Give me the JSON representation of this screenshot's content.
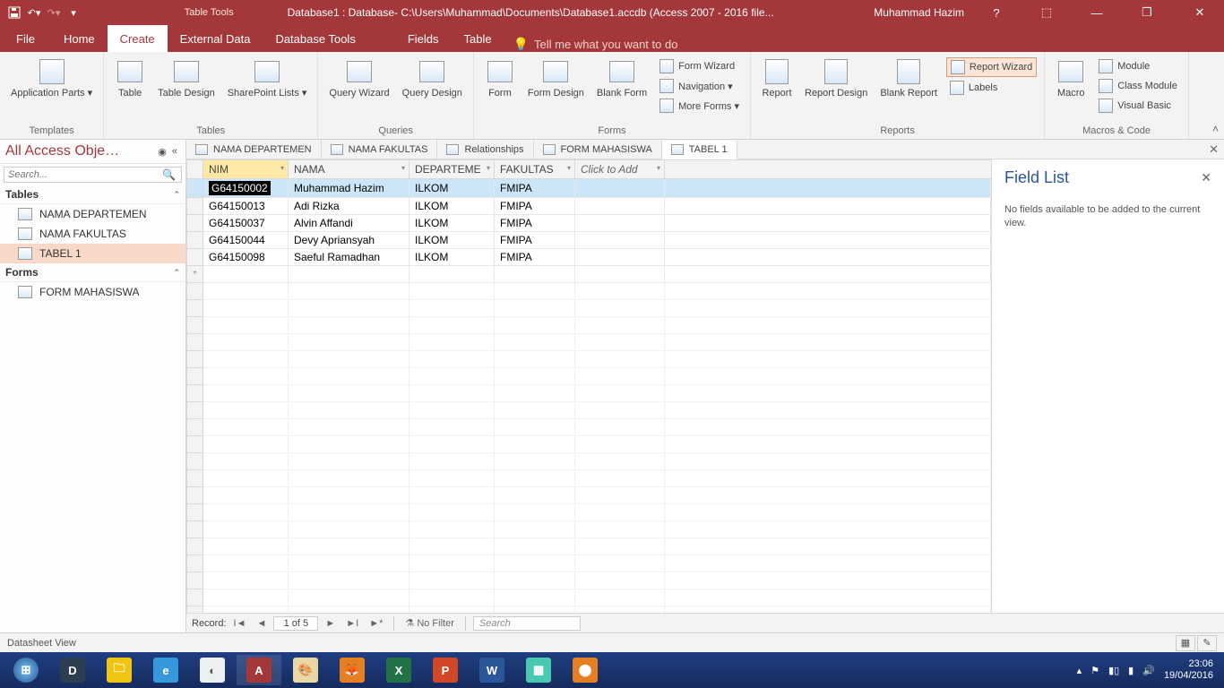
{
  "titlebar": {
    "table_tools": "Table Tools",
    "title": "Database1 : Database- C:\\Users\\Muhammad\\Documents\\Database1.accdb (Access 2007 - 2016 file...",
    "user": "Muhammad Hazim"
  },
  "tabs": {
    "file": "File",
    "home": "Home",
    "create": "Create",
    "external": "External Data",
    "dbtools": "Database Tools",
    "fields": "Fields",
    "table": "Table",
    "tellme": "Tell me what you want to do"
  },
  "ribbon": {
    "templates": {
      "app_parts": "Application\nParts ▾",
      "group": "Templates"
    },
    "tables": {
      "table": "Table",
      "table_design": "Table\nDesign",
      "sp_lists": "SharePoint\nLists ▾",
      "group": "Tables"
    },
    "queries": {
      "qwizard": "Query\nWizard",
      "qdesign": "Query\nDesign",
      "group": "Queries"
    },
    "forms": {
      "form": "Form",
      "form_design": "Form\nDesign",
      "blank_form": "Blank\nForm",
      "form_wizard": "Form Wizard",
      "navigation": "Navigation ▾",
      "more_forms": "More Forms ▾",
      "group": "Forms"
    },
    "reports": {
      "report": "Report",
      "report_design": "Report\nDesign",
      "blank_report": "Blank\nReport",
      "report_wizard": "Report Wizard",
      "labels": "Labels",
      "group": "Reports"
    },
    "macros": {
      "macro": "Macro",
      "module": "Module",
      "class_module": "Class Module",
      "visual_basic": "Visual Basic",
      "group": "Macros & Code"
    }
  },
  "nav": {
    "header": "All Access Obje…",
    "search_placeholder": "Search...",
    "tables_label": "Tables",
    "forms_label": "Forms",
    "tables": [
      "NAMA DEPARTEMEN",
      "NAMA FAKULTAS",
      "TABEL 1"
    ],
    "forms": [
      "FORM MAHASISWA"
    ]
  },
  "doctabs": [
    "NAMA DEPARTEMEN",
    "NAMA FAKULTAS",
    "Relationships",
    "FORM MAHASISWA",
    "TABEL 1"
  ],
  "columns": {
    "c1": "NIM",
    "c2": "NAMA",
    "c3": "DEPARTEME",
    "c4": "FAKULTAS",
    "c5": "Click to Add"
  },
  "rows": [
    {
      "nim": "G64150002",
      "nama": "Muhammad Hazim",
      "dep": "ILKOM",
      "fak": "FMIPA"
    },
    {
      "nim": "G64150013",
      "nama": "Adi Rizka",
      "dep": "ILKOM",
      "fak": "FMIPA"
    },
    {
      "nim": "G64150037",
      "nama": "Alvin Affandi",
      "dep": "ILKOM",
      "fak": "FMIPA"
    },
    {
      "nim": "G64150044",
      "nama": "Devy Apriansyah",
      "dep": "ILKOM",
      "fak": "FMIPA"
    },
    {
      "nim": "G64150098",
      "nama": "Saeful Ramadhan",
      "dep": "ILKOM",
      "fak": "FMIPA"
    }
  ],
  "recordnav": {
    "label": "Record:",
    "pos": "1 of 5",
    "nofilter": "No Filter",
    "search": "Search"
  },
  "fieldlist": {
    "title": "Field List",
    "msg": "No fields available to be added to the current view."
  },
  "statusbar": {
    "view": "Datasheet View"
  },
  "taskbar": {
    "time": "23:06",
    "date": "19/04/2016"
  }
}
